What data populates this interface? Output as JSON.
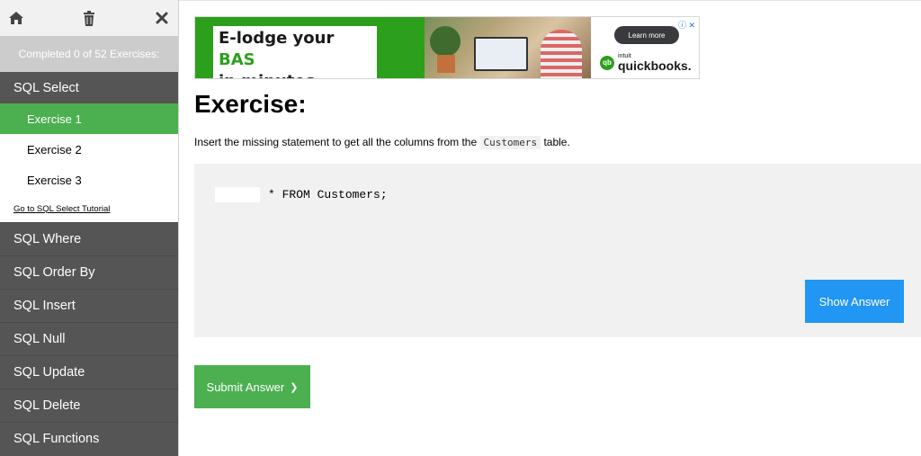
{
  "sidebar": {
    "progress_text": "Completed 0 of 52 Exercises:",
    "current_section": "SQL Select",
    "sub_items": [
      {
        "label": "Exercise 1",
        "active": true
      },
      {
        "label": "Exercise 2",
        "active": false
      },
      {
        "label": "Exercise 3",
        "active": false
      }
    ],
    "tutorial_link": "Go to SQL Select Tutorial",
    "menu": [
      "SQL Where",
      "SQL Order By",
      "SQL Insert",
      "SQL Null",
      "SQL Update",
      "SQL Delete",
      "SQL Functions"
    ],
    "icons": [
      "home-icon",
      "trash-icon",
      "close-icon"
    ]
  },
  "ad": {
    "headline_line1_prefix": "E-lodge your ",
    "headline_line1_highlight": "BAS",
    "headline_line2": "in minutes",
    "cta": "Learn more",
    "brand_small": "intuit",
    "brand": "quickbooks.",
    "accent": "#2ca01c"
  },
  "main": {
    "title": "Exercise:",
    "instruction_before": "Insert the missing statement to get all the columns from the",
    "instruction_code": "Customers",
    "instruction_after": "table.",
    "answer_value": "",
    "code_rest": "* FROM Customers;",
    "show_answer": "Show Answer",
    "submit": "Submit Answer",
    "submit_chevron": "❯"
  },
  "colors": {
    "green": "#4caf50",
    "blue": "#2196f3",
    "sidebar_dark": "#555555"
  }
}
